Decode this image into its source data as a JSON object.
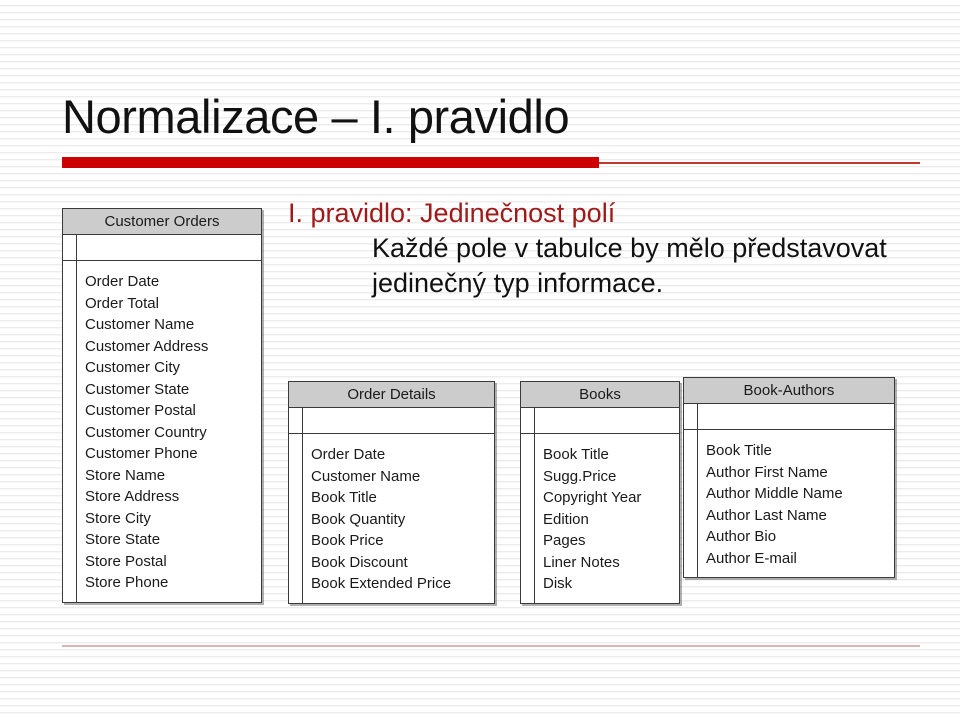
{
  "slide": {
    "title": "Normalizace – I. pravidlo",
    "body": {
      "lead": "I. pravidlo: Jedinečnost polí",
      "rest": "Každé pole v tabulce by mělo představovat jedinečný typ informace."
    },
    "colors": {
      "title_rule": "#cc0000",
      "lead_text": "#a01a1a",
      "body_text": "#111111",
      "table_header_fill": "#cccccc",
      "table_border": "#3a3a3a",
      "bottom_rule": "#d8b6b6"
    }
  },
  "tables": [
    {
      "name": "Customer Orders",
      "fields": [
        "Order Date",
        "Order Total",
        "Customer Name",
        "Customer Address",
        "Customer City",
        "Customer State",
        "Customer Postal",
        "Customer Country",
        "Customer Phone",
        "Store Name",
        "Store Address",
        "Store City",
        "Store State",
        "Store Postal",
        "Store Phone"
      ]
    },
    {
      "name": "Order Details",
      "fields": [
        "Order Date",
        "Customer Name",
        "Book Title",
        "Book Quantity",
        "Book Price",
        "Book Discount",
        "Book Extended Price"
      ]
    },
    {
      "name": "Books",
      "fields": [
        "Book Title",
        "Sugg.Price",
        "Copyright Year",
        "Edition",
        "Pages",
        "Liner Notes",
        "Disk"
      ]
    },
    {
      "name": "Book-Authors",
      "fields": [
        "Book Title",
        "Author First Name",
        "Author Middle Name",
        "Author Last Name",
        "Author Bio",
        "Author E-mail"
      ]
    }
  ]
}
